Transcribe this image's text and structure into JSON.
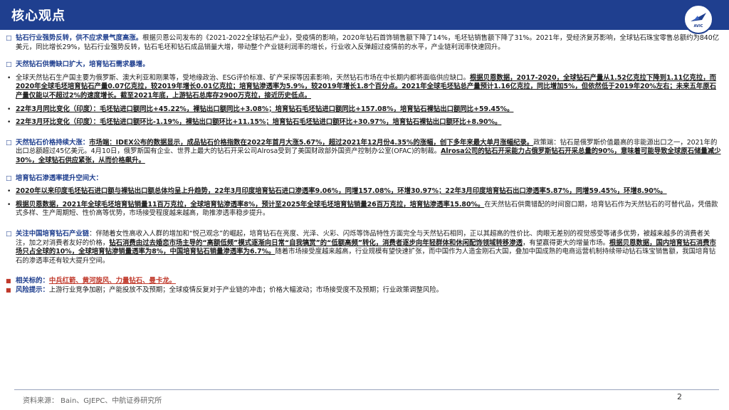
{
  "header": {
    "title": "核心观点",
    "logo_text": "AVIC"
  },
  "colors": {
    "brand": "#1f3f8f",
    "accent_red": "#c0392b"
  },
  "sections": [
    {
      "id": "s1",
      "marker": "□",
      "segments": [
        {
          "text": "钻石行业强势反转，供不应求景气度高涨。",
          "style": "head-blue"
        },
        {
          "text": "根据贝恩公司发布的《2021-2022全球钻石产业》，受疫情的影响，2020年钻石首饰销售额下降了14%，毛坯钻销售额下降了31%。2021年，受经济复苏影响，全球钻石珠宝零售总额约为840亿美元，同比增长29%，钻石行业强势反转，钻石毛坯和钻石成品销量大增，带动整个产业链利润率的增长，行业收入反弹超过疫情前的水平，产业链利润率快速回升。",
          "style": ""
        }
      ]
    },
    {
      "id": "s2",
      "marker": "□",
      "segments": [
        {
          "text": "天然钻石供需缺口扩大，培育钻石需求暴增。",
          "style": "head-blue"
        }
      ]
    },
    {
      "id": "s3",
      "marker": "•",
      "segments": [
        {
          "text": "全球天然钻石生产国主要为俄罗斯、澳大利亚和刚果等，受地缘政治、ESG评价标准、矿产采探等因素影响，天然钻石市场在中长期内都将面临供应缺口。",
          "style": ""
        },
        {
          "text": "根据贝恩数据，2017-2020，全球钻石产量从1.52亿克拉下降到1.11亿克拉，而2020年全球毛坯培育钻石产量0.07亿克拉，较2019年增长0.01亿克拉；培育钻渗透率为5.9%，较2019年增长1.8个百分点。2021年全球毛坯钻总产量预计1.16亿克拉，同比增加5%，但依然低于2019年20%左右；未来五年原石产量仅能以不超过2%的速度增长。截至2021年底，上游钻石总库存2900万克拉，接近历史低点。",
          "style": "ul"
        }
      ]
    },
    {
      "id": "s4",
      "marker": "•",
      "segments": [
        {
          "text": "22年3月同比变化（印度）：毛坯钻进口额同比+45.22%，裸钻出口额同比+3.08%；培育钻石毛坯钻进口额同比+157.08%，培育钻石裸钻出口额同比+59.45%。",
          "style": "ul"
        }
      ]
    },
    {
      "id": "s5",
      "marker": "•",
      "segments": [
        {
          "text": "22年3月环比变化（印度）：毛坯钻进口额环比-1.19%，裸钻出口额环比+11.15%；培育钻石毛坯钻进口额环比+30.97%，培育钻石裸钻出口额环比+8.90%。",
          "style": "ul"
        }
      ]
    },
    {
      "id": "s6",
      "marker": "□",
      "segments": [
        {
          "text": "天然钻石价格持续大涨：",
          "style": "head-blue"
        },
        {
          "text": "市场端：IDEX公布的数据显示，成品钻石价格指数在2022年首月大涨5.67%，超过2021年12月份4.35%的涨幅，创下多年来最大单月涨幅纪录。",
          "style": "ul"
        },
        {
          "text": "政策端：钻石是俄罗斯价值最高的非能源出口之一，2021年的出口总额超过45亿美元。4月10日，俄罗斯国有企业、世界上最大的钻石开采公司Alrosa受到了美国财政部外国资产控制办公室(OFAC)的制裁。",
          "style": ""
        },
        {
          "text": "Alrosa公司的钻石开采能力占俄罗斯钻石开采总量的90%，意味着可能导致全球原石储量减少30%，全球钻石供应紧张，从而价格飙升。",
          "style": "ul"
        }
      ]
    },
    {
      "id": "s7",
      "marker": "□",
      "segments": [
        {
          "text": "培育钻石渗透率提升空间大：",
          "style": "head-blue"
        }
      ]
    },
    {
      "id": "s8",
      "marker": "•",
      "segments": [
        {
          "text": "2020年以来印度毛坯钻石进口额与裸钻出口额总体均呈上升趋势，22年3月印度培育钻石进口渗透率9.06%，同增157.08%，环增30.97%；22年3月印度培育钻石出口渗透率5.87%，同增59.45%，环增8.90%。",
          "style": "ul"
        }
      ]
    },
    {
      "id": "s9",
      "marker": "•",
      "segments": [
        {
          "text": "根据贝恩数据，2021年全球毛坯培育钻销量11百万克拉，全球培育钻渗透率8%，预计至2025年全球毛坯培育钻销量26百万克拉，培育钻渗透率15.80%。",
          "style": "ul"
        },
        {
          "text": "在天然钻石供需错配的时间窗口期，培育钻石作为天然钻石的可替代品，凭借款式多样、生产周期短、性价高等优势，市场接受程度越来越高，助推渗透率稳步提升。",
          "style": ""
        }
      ]
    },
    {
      "id": "s10",
      "marker": "□",
      "segments": [
        {
          "text": "关注中国培育钻石产业链",
          "style": "head-blue"
        },
        {
          "text": "：伴随着女性高收入人群的增加和“悦己观念”的崛起，培育钻石在亮度、光泽、火彩、闪烁等饰品特性方面完全与天然钻石相同，正以其超高的性价比、肉眼无差别的视觉感受等诸多优势，被越来越多的消费者关注，加之对消费者友好的价格，",
          "style": ""
        },
        {
          "text": "钻石消费由过去婚恋市场主导的“高额低频”模式逐渐向日常“自我犒赏”的“低额高频”转化，消费者逐步向年轻群体和休闲配饰领域转移渗透",
          "style": "ul"
        },
        {
          "text": "，有望赢得更大的增量市场。",
          "style": ""
        },
        {
          "text": "根据贝恩数据，国内培育钻石消费市场只占全球的10%，全球培育钻渗销量透率为8%，中国培育钻石销量渗透率为6.7%。",
          "style": "ul"
        },
        {
          "text": "随着市场接受度越来越高，行业规模有望快速扩张，而中国作为人造金刚石大国，叠加中国成熟的电商运营机制持续带动钻石珠宝销售额，我国培育钻石的渗透率还有较大提升空间。",
          "style": ""
        }
      ]
    },
    {
      "id": "s11",
      "marker": "■",
      "segments": [
        {
          "text": "相关标的：",
          "style": "head-blue"
        },
        {
          "text": "中兵红箭、黄河旋风、力量钻石、曼卡龙。",
          "style": "red"
        }
      ]
    },
    {
      "id": "s12",
      "marker": "■",
      "segments": [
        {
          "text": "风险提示：",
          "style": "head-blue"
        },
        {
          "text": "上游行业竞争加剧；产能投放不及预期；全球疫情反复对于产业链的冲击；价格大幅波动；市场接受度不及预期；行业政策调整风险。",
          "style": ""
        }
      ]
    }
  ],
  "footer": {
    "source": "资料来源： Bain、GJEPC、中航证券研究所",
    "page": "2"
  }
}
